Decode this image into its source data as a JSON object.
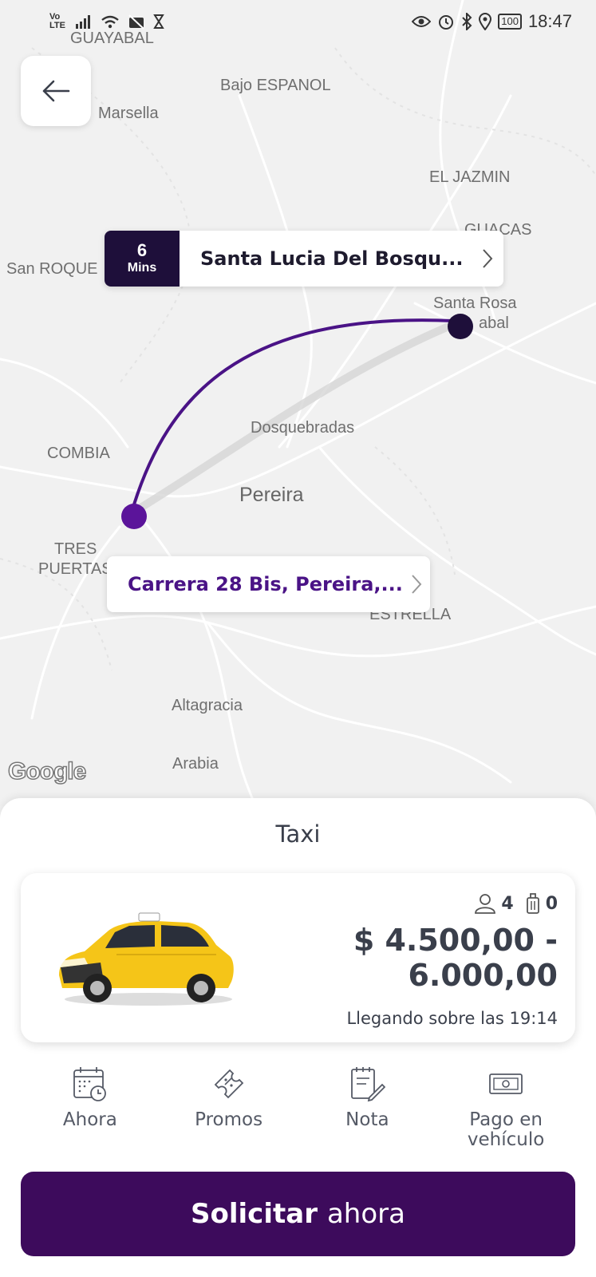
{
  "status_bar": {
    "network": "Vo LTE",
    "time": "18:47",
    "battery": "100"
  },
  "map": {
    "places": [
      "GUAYABAL",
      "Marsella",
      "Bajo ESPANOL",
      "EL JAZMIN",
      "GUACAS",
      "San ROQUE",
      "Santa Rosa",
      "abal",
      "Dosquebradas",
      "COMBIA",
      "Pereira",
      "TRES",
      "PUERTAS",
      "ESTRELLA",
      "Altagracia",
      "Arabia"
    ],
    "logo": "Google"
  },
  "destination": {
    "eta_value": "6",
    "eta_unit": "Mins",
    "address": "Santa Lucia Del Bosqu..."
  },
  "origin": {
    "address": "Carrera 28 Bis, Pereira,..."
  },
  "sheet": {
    "title": "Taxi",
    "ride": {
      "passengers": "4",
      "luggage": "0",
      "price_line1": "$ 4.500,00 -",
      "price_line2": "6.000,00",
      "arrival": "Llegando sobre las 19:14"
    },
    "options": [
      {
        "label": "Ahora",
        "icon": "calendar-clock-icon"
      },
      {
        "label": "Promos",
        "icon": "ticket-icon"
      },
      {
        "label": "Nota",
        "icon": "note-icon"
      },
      {
        "label": "Pago en vehículo",
        "icon": "cash-icon"
      }
    ],
    "cta": {
      "bold": "Solicitar",
      "rest": "ahora"
    }
  },
  "colors": {
    "route": "#4a1386",
    "eta_bg": "#1e0f3a",
    "cta_bg": "#3d0b5c",
    "taxi_yellow": "#f5c518"
  }
}
